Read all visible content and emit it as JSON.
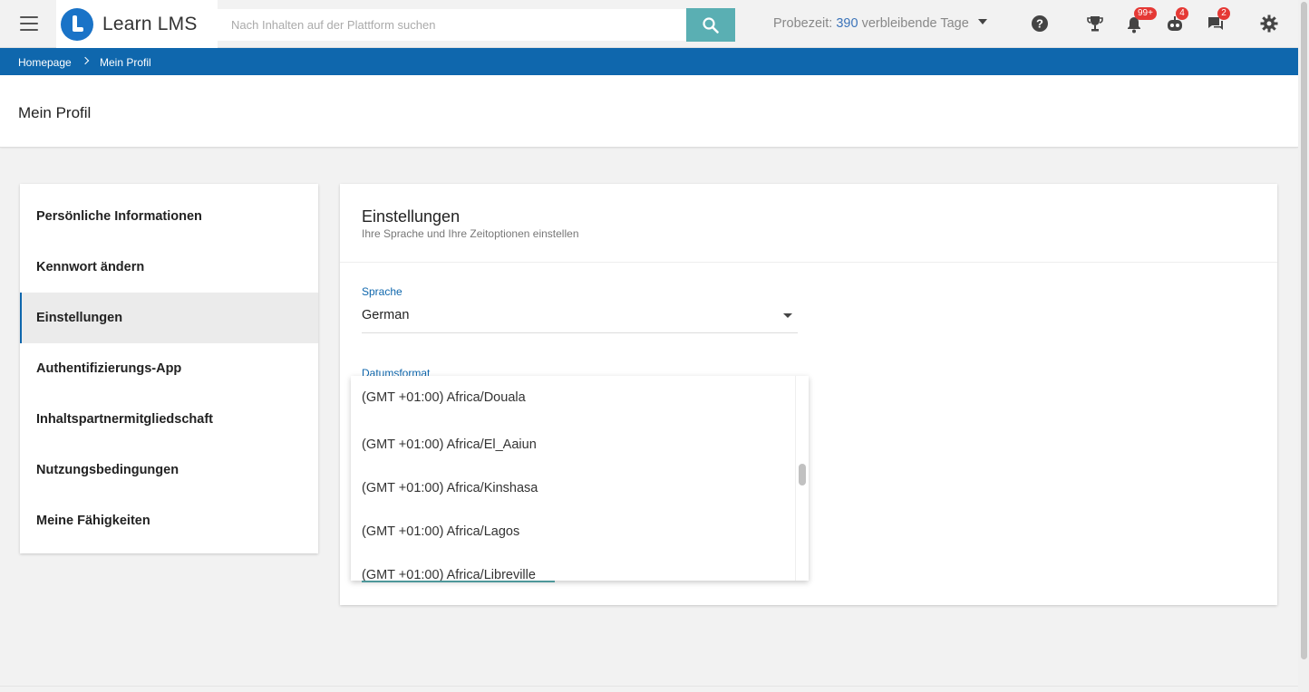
{
  "app": {
    "name": "Learn LMS"
  },
  "search": {
    "placeholder": "Nach Inhalten auf der Plattform suchen"
  },
  "trial": {
    "prefix": "Probezeit:",
    "days": "390",
    "suffix": "verbleibende Tage"
  },
  "badges": {
    "notifications": "99+",
    "bot": "4",
    "messages": "2"
  },
  "breadcrumb": {
    "home": "Homepage",
    "current": "Mein Profil"
  },
  "page": {
    "title": "Mein Profil"
  },
  "sidebar": {
    "items": [
      {
        "label": "Persönliche Informationen"
      },
      {
        "label": "Kennwort ändern"
      },
      {
        "label": "Einstellungen"
      },
      {
        "label": "Authentifizierungs-App"
      },
      {
        "label": "Inhaltspartnermitgliedschaft"
      },
      {
        "label": "Nutzungsbedingungen"
      },
      {
        "label": "Meine Fähigkeiten"
      }
    ]
  },
  "settings": {
    "title": "Einstellungen",
    "subtitle": "Ihre Sprache und Ihre Zeitoptionen einstellen",
    "language_label": "Sprache",
    "language_value": "German",
    "date_format_label": "Datumsformat"
  },
  "timezone_options": [
    "(GMT +01:00) Africa/Douala",
    "(GMT +01:00) Africa/El_Aaiun",
    "(GMT +01:00) Africa/Kinshasa",
    "(GMT +01:00) Africa/Lagos",
    "(GMT +01:00) Africa/Libreville"
  ],
  "colors": {
    "brand_blue": "#0f67ad",
    "accent_teal": "#5aafb3",
    "badge_red": "#e53935"
  }
}
